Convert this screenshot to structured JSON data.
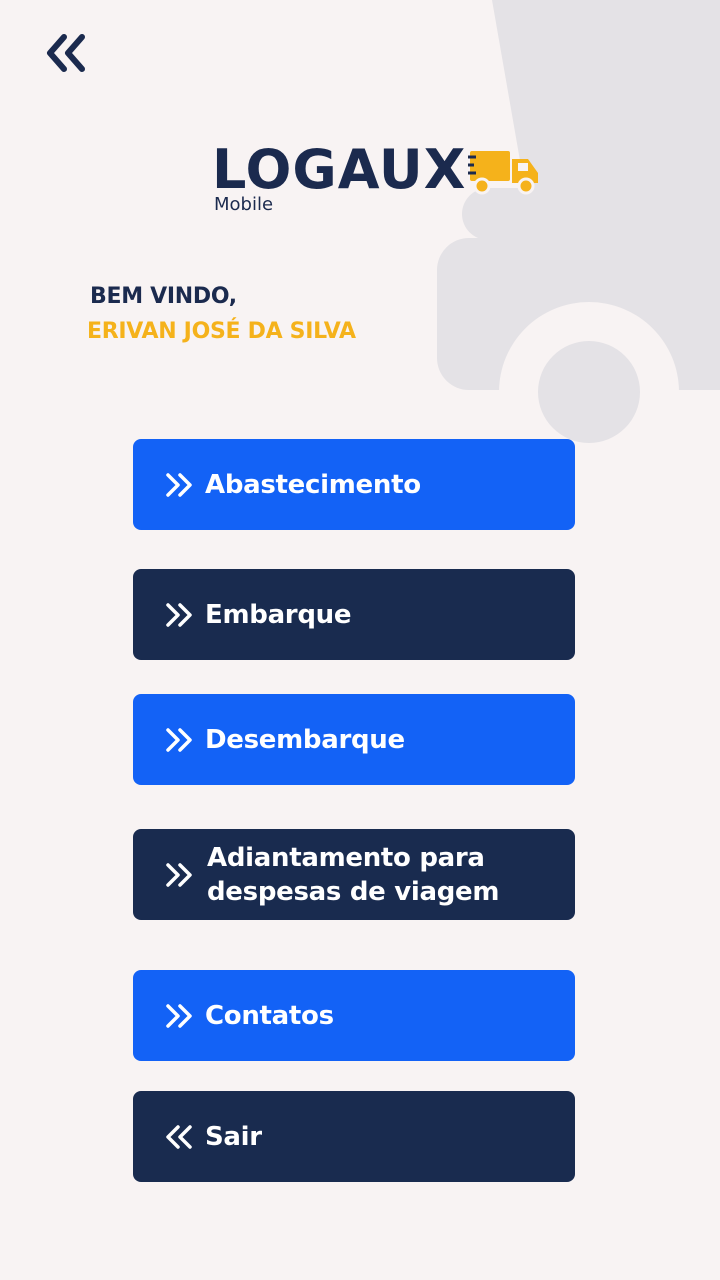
{
  "header": {
    "back_icon": "double-chevron-left-icon"
  },
  "logo": {
    "title": "LOGAUX",
    "subtitle": "Mobile",
    "icon": "truck-icon",
    "accent_color": "#f5b21b"
  },
  "welcome": {
    "greeting": "BEM VINDO,",
    "user_name": "ERIVAN JOSÉ DA SILVA"
  },
  "menu": {
    "items": [
      {
        "label": "Abastecimento",
        "icon": "double-chevron-right-icon",
        "color": "#1362f6"
      },
      {
        "label": "Embarque",
        "icon": "double-chevron-right-icon",
        "color": "#192b4f"
      },
      {
        "label": "Desembarque",
        "icon": "double-chevron-right-icon",
        "color": "#1362f6"
      },
      {
        "label": "Adiantamento para despesas de viagem",
        "icon": "double-chevron-right-icon",
        "color": "#192b4f"
      },
      {
        "label": "Contatos",
        "icon": "double-chevron-right-icon",
        "color": "#1362f6"
      },
      {
        "label": "Sair",
        "icon": "double-chevron-left-icon",
        "color": "#192b4f"
      }
    ]
  },
  "colors": {
    "background": "#f8f3f3",
    "primary_blue": "#1362f6",
    "navy": "#192b4f",
    "text_navy": "#1b2a4e",
    "highlight_yellow": "#f5b21b",
    "decor_gray": "#e4e2e6"
  }
}
